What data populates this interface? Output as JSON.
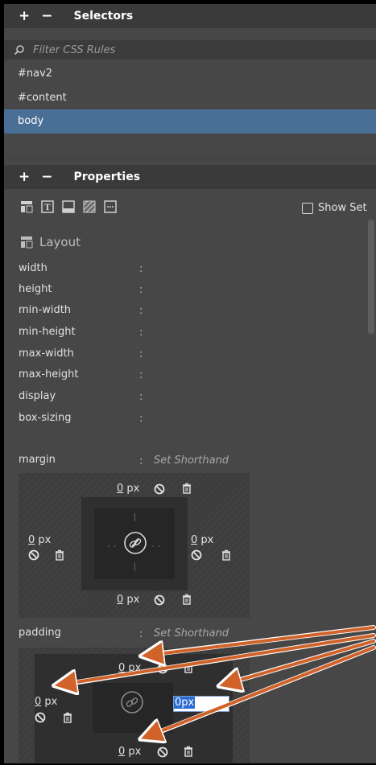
{
  "selectors": {
    "plus": "+",
    "minus": "−",
    "title": "Selectors",
    "filter_placeholder": "Filter CSS Rules",
    "items": [
      "#nav2",
      "#content",
      "body"
    ]
  },
  "properties": {
    "plus": "+",
    "minus": "−",
    "title": "Properties",
    "show_set_label": "Show Set",
    "layout_title": "Layout",
    "props": [
      "width",
      "height",
      "min-width",
      "min-height",
      "max-width",
      "max-height",
      "display",
      "box-sizing"
    ],
    "colon": ":",
    "margin_label": "margin",
    "padding_label": "padding",
    "set_shorthand": "Set Shorthand",
    "margin": {
      "top_num": "0",
      "right_num": "0",
      "bottom_num": "0",
      "left_num": "0",
      "unit": "px"
    },
    "padding": {
      "top_num": "0",
      "left_num": "0",
      "bottom_num": "0",
      "right_edit": "0px",
      "unit": "px"
    }
  },
  "colors": {
    "accent": "#4a6f96",
    "arrow": "#d0622a"
  }
}
